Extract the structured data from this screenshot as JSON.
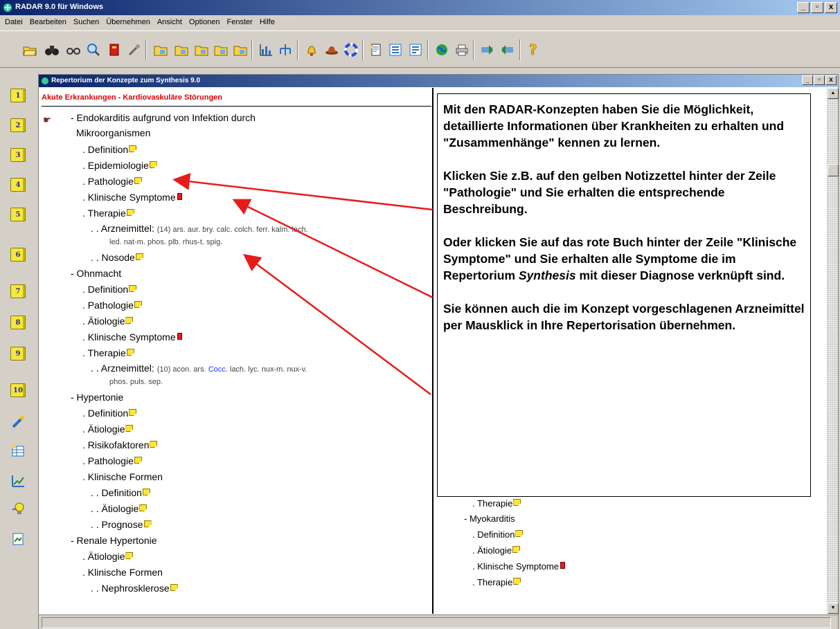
{
  "window": {
    "title": "RADAR 9.0 für Windows",
    "minimize": "_",
    "maximize": "▫",
    "close": "x"
  },
  "menu": [
    "Datei",
    "Bearbeiten",
    "Suchen",
    "Übernehmen",
    "Ansicht",
    "Optionen",
    "Fenster",
    "Hilfe"
  ],
  "sidebar": {
    "books": [
      "1",
      "2",
      "3",
      "4",
      "5",
      "6",
      "7",
      "8",
      "9",
      "10"
    ]
  },
  "child": {
    "title": "Repertorium der Konzepte zum Synthesis 9.0",
    "subheading": "Akute Erkrankungen - Kardiovaskuläre Störungen"
  },
  "tree_left": {
    "endo_l1": "- Endokarditis aufgrund von Infektion durch",
    "endo_l2": "Mikroorganismen",
    "endo_def": ". Definition",
    "endo_epi": ". Epidemiologie",
    "endo_path": ". Pathologie",
    "endo_klin": ". Klinische Symptome",
    "endo_ther": ". Therapie",
    "endo_arz_label": ". . Arzneimittel:",
    "endo_arz_rem1": "(14) ars. aur. bry. calc. colch. ferr. kalm. lach.",
    "endo_arz_rem2": "led. nat-m. phos. plb. rhus-t. spig.",
    "endo_noso": ". . Nosode",
    "ohn": "- Ohnmacht",
    "ohn_def": ". Definition",
    "ohn_path": ". Pathologie",
    "ohn_aeti": ". Ätiologie",
    "ohn_klin": ". Klinische Symptome",
    "ohn_ther": ". Therapie",
    "ohn_arz_label": ". . Arzneimittel:",
    "ohn_arz_rem1a": "(10) acon. ars.",
    "ohn_arz_rem1b": "Cocc.",
    "ohn_arz_rem1c": "lach. lyc. nux-m. nux-v.",
    "ohn_arz_rem2": "phos. puls. sep.",
    "hyp": "- Hypertonie",
    "hyp_def": ". Definition",
    "hyp_aeti": ". Ätiologie",
    "hyp_risk": ". Risikofaktoren",
    "hyp_path": ". Pathologie",
    "hyp_klin": ". Klinische Formen",
    "hyp_klin_def": ". . Definition",
    "hyp_klin_aeti": ". . Ätiologie",
    "hyp_klin_prog": ". . Prognose",
    "ren": "- Renale Hypertonie",
    "ren_aeti": ". Ätiologie",
    "ren_klin": ". Klinische Formen",
    "ren_nephro": ". . Nephrosklerose"
  },
  "tree_right": {
    "ther_partial": ". Therapie",
    "myo": "- Myokarditis",
    "myo_def": ". Definition",
    "myo_aeti": ". Ätiologie",
    "myo_klin": ". Klinische Symptome",
    "myo_ther": ". Therapie"
  },
  "callout": {
    "p1": "Mit den RADAR-Konzepten haben Sie die Möglichkeit, detaillierte Informationen über Krankheiten zu erhalten und \"Zusammenhänge\" kennen zu lernen.",
    "p2": "Klicken Sie z.B. auf den gelben Notizzettel hinter der Zeile \"Pathologie\" und Sie erhalten die entsprechende Beschreibung.",
    "p3a": "Oder klicken Sie auf das rote Buch hinter der Zeile \"Klinische Symptome\" und Sie erhalten alle Symptome die im Repertorium ",
    "p3b": "Synthesis",
    "p3c": " mit dieser Diagnose verknüpft sind.",
    "p4": "Sie können auch die im Konzept vorgeschlagenen Arzneimittel per Mausklick in Ihre Repertorisation übernehmen."
  },
  "colors": {
    "titlebar": "#0a246a",
    "subheading": "#e00000",
    "arrow": "#e81b1b",
    "note": "#ffe533",
    "blue_remedy": "#1a3aff"
  },
  "icons": [
    "open-icon",
    "binoculars-icon",
    "glasses-icon",
    "magnifier-icon",
    "red-book-icon",
    "tools-icon",
    "folder-icon",
    "chart-icon",
    "tree-icon",
    "bell-icon",
    "hat-icon",
    "lifebuoy-icon",
    "page-icon",
    "list-icon",
    "globe-icon",
    "printer-icon",
    "forward-icon",
    "back-icon",
    "help-icon"
  ]
}
